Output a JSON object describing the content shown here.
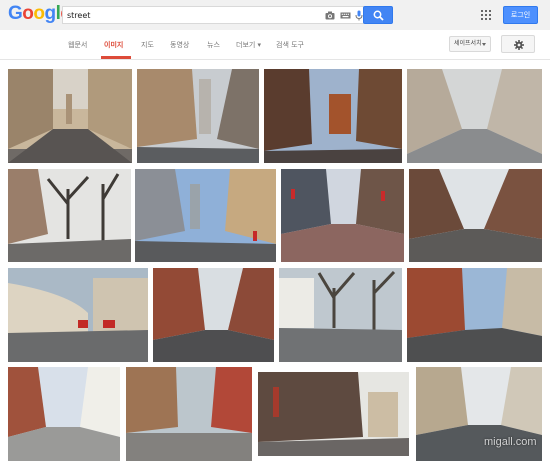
{
  "header": {
    "logo": {
      "letters": [
        "G",
        "o",
        "o",
        "g",
        "l",
        "e"
      ]
    },
    "search": {
      "value": "street"
    },
    "login_label": "로그인"
  },
  "tabs": [
    {
      "label": "웹문서",
      "active": false
    },
    {
      "label": "이미지",
      "active": true
    },
    {
      "label": "지도",
      "active": false
    },
    {
      "label": "동영상",
      "active": false
    },
    {
      "label": "뉴스",
      "active": false
    },
    {
      "label": "더보기 ▾",
      "active": false
    },
    {
      "label": "검색 도구",
      "active": false
    }
  ],
  "safesearch_label": "세이프서치",
  "icons": {
    "camera": "camera-icon",
    "keyboard": "keyboard-icon",
    "mic": "mic-icon",
    "search": "search-icon",
    "apps": "apps-grid-icon",
    "gear": "gear-icon"
  },
  "colors": {
    "brand_blue": "#4285f4",
    "active_tab": "#dd4b39",
    "header_bg": "#f1f1f1"
  },
  "results": {
    "rows": [
      {
        "images": [
          "street-victorian-terrace",
          "street-city-tower",
          "street-brick-row",
          "street-foggy-avenue"
        ]
      },
      {
        "images": [
          "street-bare-trees",
          "street-city-crossing",
          "street-shops-red-flags",
          "street-brick-terrace-lane"
        ]
      },
      {
        "images": [
          "street-crescent-buses",
          "street-red-brick-market",
          "street-white-houses-trees",
          "street-red-brick-cars"
        ]
      },
      {
        "images": [
          "street-cobbled-alley",
          "street-red-buildings-crowd",
          "street-old-town-shopfronts",
          "street-georgian-cars"
        ]
      }
    ]
  },
  "watermark": "migall.com"
}
